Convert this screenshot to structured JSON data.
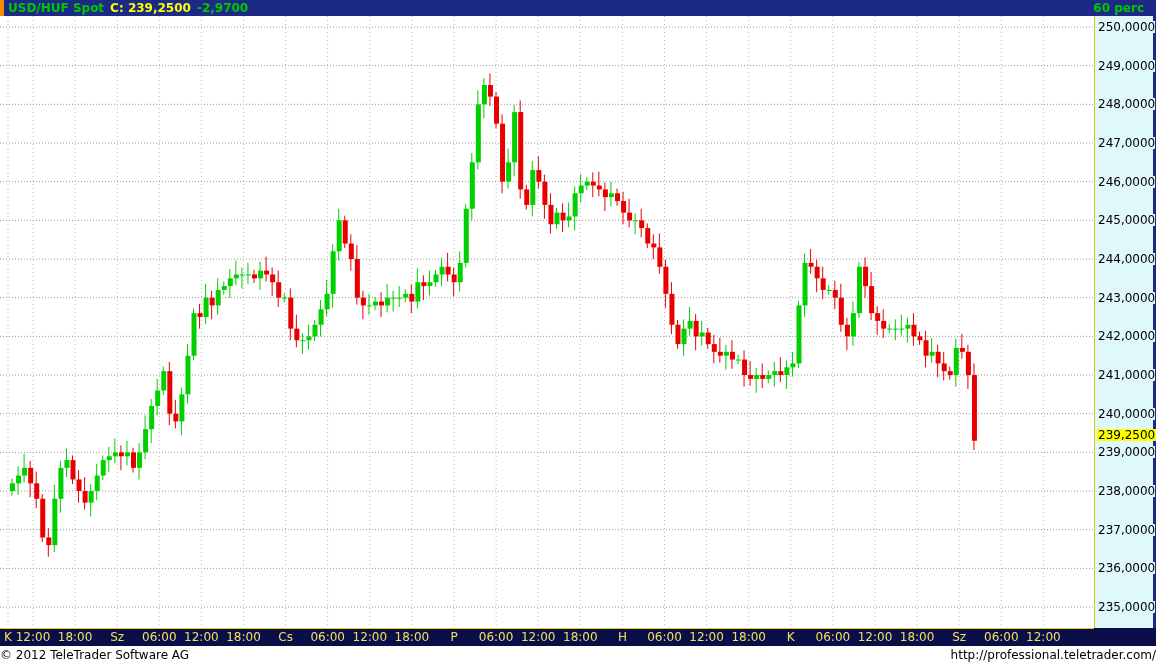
{
  "header": {
    "symbol": "USD/HUF Spot",
    "close": "C: 239,2500",
    "change": "-2,9700",
    "period": "60 perc"
  },
  "price_axis": {
    "ticks": [
      "250,0000",
      "249,0000",
      "248,0000",
      "247,0000",
      "246,0000",
      "245,0000",
      "244,0000",
      "243,0000",
      "242,0000",
      "241,0000",
      "240,0000",
      "239,0000",
      "238,0000",
      "237,0000",
      "236,0000",
      "235,0000"
    ],
    "last_price": "239,2500"
  },
  "time_axis": {
    "labels": [
      "K",
      "12:00",
      "18:00",
      "Sz",
      "06:00",
      "12:00",
      "18:00",
      "Cs",
      "06:00",
      "12:00",
      "18:00",
      "P",
      "06:00",
      "12:00",
      "18:00",
      "H",
      "06:00",
      "12:00",
      "18:00",
      "K",
      "06:00",
      "12:00",
      "18:00",
      "Sz",
      "06:00",
      "12:00"
    ]
  },
  "footer": {
    "copyright": "© 2012 TeleTrader Software AG",
    "url": "http://professional.teletrader.com/"
  }
}
